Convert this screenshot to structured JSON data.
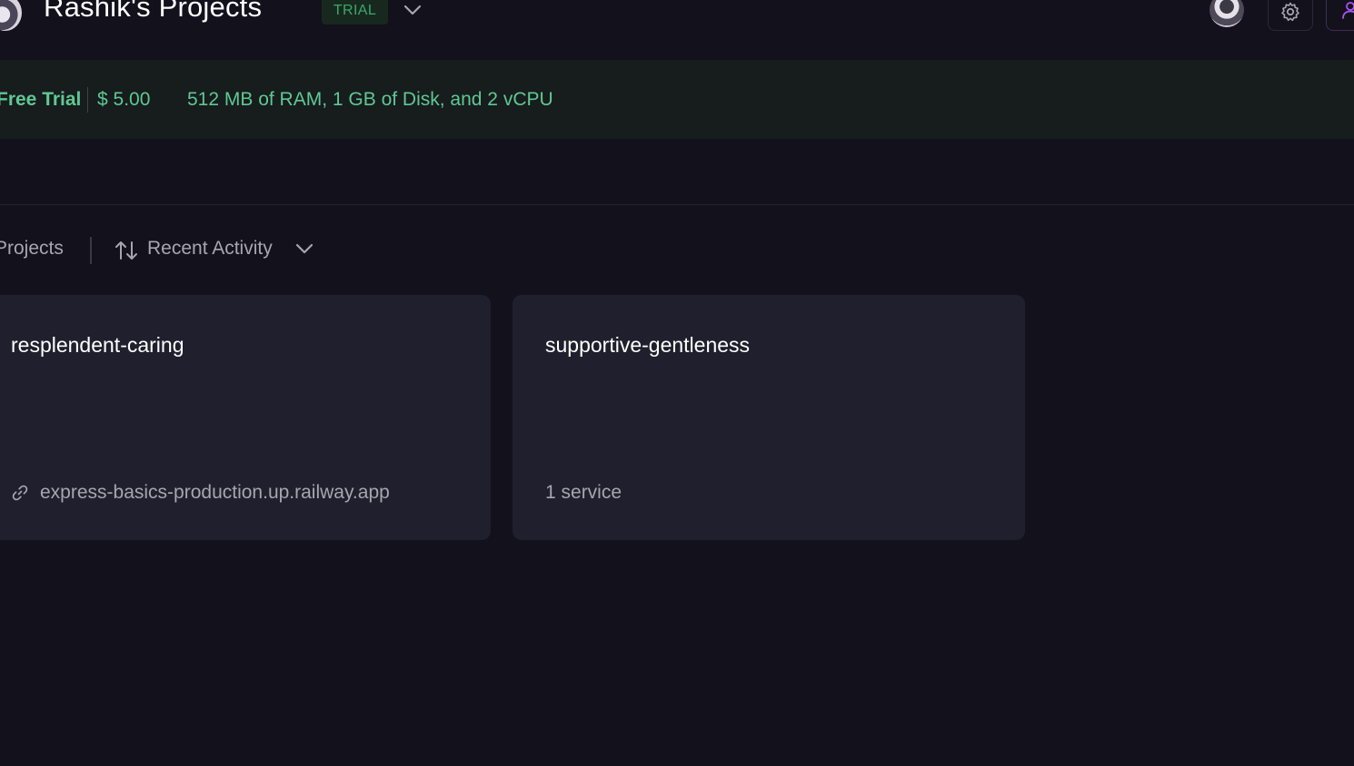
{
  "header": {
    "title": "Rashik's Projects",
    "badge": "TRIAL"
  },
  "banner": {
    "plan": "Free Trial",
    "price": "$ 5.00",
    "resources": "512 MB of RAM, 1 GB of Disk, and 2 vCPU"
  },
  "filters": {
    "filter_label": "Projects",
    "sort_label": "Recent Activity"
  },
  "projects": [
    {
      "name": "resplendent-caring",
      "footer": "express-basics-production.up.railway.app"
    },
    {
      "name": "supportive-gentleness",
      "footer": "1 service"
    }
  ],
  "colors": {
    "background": "#13111c",
    "card": "#201f2d",
    "banner_bg": "#171c1d",
    "trial_green": "#5fc893",
    "badge_bg": "#17291f",
    "muted_text": "#a7a5b0",
    "accent_purple": "#a855f7"
  },
  "icons": {
    "header_dropdown": "chevron-down-icon",
    "settings": "gear-icon",
    "account": "person-icon",
    "sort": "sort-arrows-icon",
    "sort_dropdown": "chevron-down-icon",
    "project_link": "link-icon"
  }
}
